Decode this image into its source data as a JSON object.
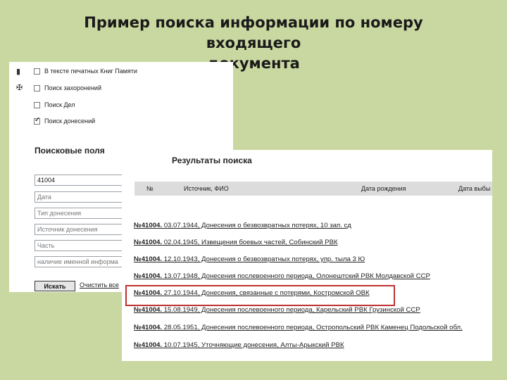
{
  "slide": {
    "title_line1": "Пример поиска информации по номеру входящего",
    "title_line2": "документа"
  },
  "left_panel": {
    "search_types": [
      {
        "label": "В тексте печатных Книг Памяти",
        "checked": false,
        "icon": "book-icon"
      },
      {
        "label": "Поиск захоронений",
        "checked": false,
        "icon": "memorial-icon"
      },
      {
        "label": "Поиск Дел",
        "checked": false
      },
      {
        "label": "Поиск донесений",
        "checked": true
      }
    ],
    "fields_heading": "Поисковые поля",
    "fields": [
      {
        "value": "41004",
        "placeholder": ""
      },
      {
        "value": "",
        "placeholder": "Дата"
      },
      {
        "value": "",
        "placeholder": "Тип донесения"
      },
      {
        "value": "",
        "placeholder": "Источник донесения"
      },
      {
        "value": "",
        "placeholder": "Часть"
      },
      {
        "value": "",
        "placeholder": "наличие именной информа"
      }
    ],
    "search_button": "Искать",
    "clear_link": "Очистить все"
  },
  "results": {
    "heading": "Результаты поиска",
    "columns": [
      "№",
      "Источник, ФИО",
      "Дата рождения",
      "Дата выбы"
    ],
    "rows": [
      {
        "num": "№41004.",
        "text": " 03.07.1944, Донесения о безвозвратных потерях, 10 зап. сд"
      },
      {
        "num": "№41004.",
        "text": " 02.04.1945, Извещения боевых частей, Собинский РВК"
      },
      {
        "num": "№41004.",
        "text": " 12.10.1943, Донесения о безвозвратных потерях, упр. тыла 3 Ю"
      },
      {
        "num": "№41004.",
        "text": " 13.07.1948, Донесения послевоенного периода, Олонештский РВК Молдавской ССР"
      },
      {
        "num": "№41004.",
        "text": " 27.10.1944, Донесения, связанные с потерями, Костромской ОВК"
      },
      {
        "num": "№41004.",
        "text": " 15.08.1949, Донесения послевоенного периода, Карельский РВК Грузинской ССР"
      },
      {
        "num": "№41004.",
        "text": " 28.05.1951, Донесения послевоенного периода, Остропольский РВК Каменец Подольской обл."
      },
      {
        "num": "№41004.",
        "text": " 10.07.1945, Уточняющие донесения, Алты-Арыкский РВК"
      }
    ],
    "highlighted_row_index": 4,
    "highlight_color": "#c03030"
  }
}
